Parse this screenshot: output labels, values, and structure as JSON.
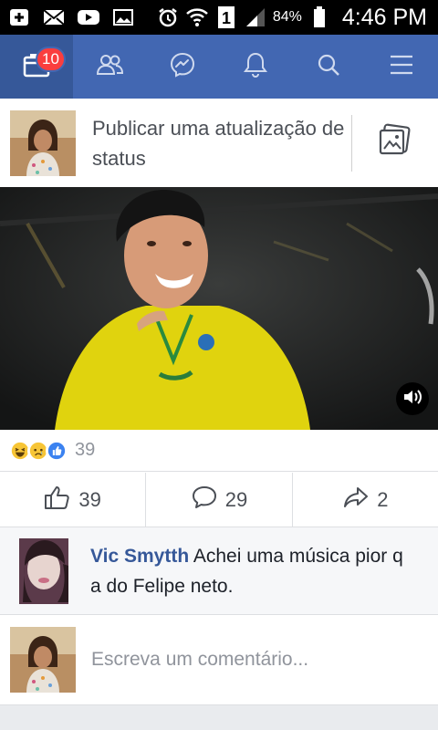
{
  "status_bar": {
    "battery_percent": "84%",
    "time": "4:46 PM",
    "icons": [
      "add-icon",
      "mail-icon",
      "youtube-icon",
      "image-icon",
      "alarm-icon",
      "wifi-icon",
      "sim-1-icon",
      "signal-icon",
      "battery-icon"
    ]
  },
  "nav": {
    "items": [
      "news-feed-icon",
      "friends-icon",
      "messenger-icon",
      "notifications-icon",
      "search-icon",
      "menu-icon"
    ],
    "badge": "10",
    "colors": {
      "bar": "#4267b2",
      "active": "#365899",
      "badge": "#fa3e3e"
    }
  },
  "composer": {
    "placeholder": "Publicar uma atualização de status"
  },
  "post": {
    "reaction_count": "39",
    "reactions": [
      "haha-icon",
      "sad-icon",
      "like-icon"
    ],
    "likes": "39",
    "comments": "29",
    "shares": "2"
  },
  "comment": {
    "author": "Vic Smytth",
    "text": " Achei uma música pior q a do Felipe neto."
  },
  "write_comment": {
    "placeholder": "Escreva um comentário..."
  }
}
